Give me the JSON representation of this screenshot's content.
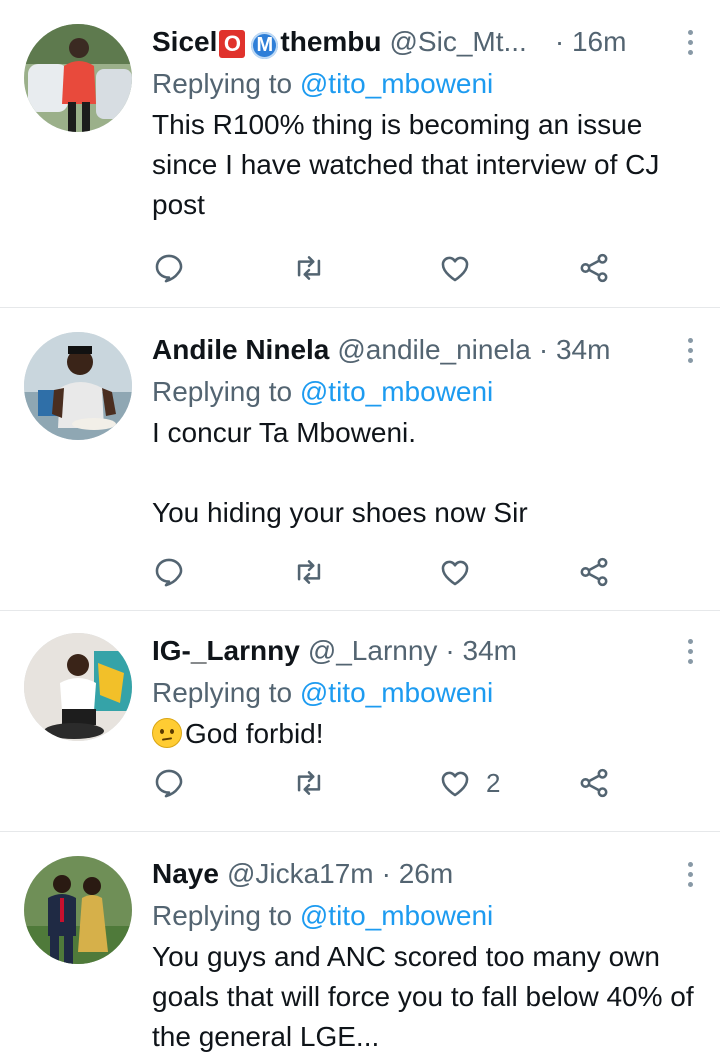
{
  "tweets": [
    {
      "name_part1": "Sicel",
      "name_badge": "O",
      "name_badge2": "M",
      "name_part2": "thembu",
      "handle": "@Sic_Mt...",
      "time": "· 16m",
      "replying_prefix": "Replying to",
      "replying_mention": "@tito_mboweni",
      "text": "This R100% thing is becoming an issue since I have watched that interview of CJ post",
      "likes": ""
    },
    {
      "name": "Andile Ninela",
      "handle": "@andile_ninela",
      "time": "· 34m",
      "replying_prefix": "Replying to",
      "replying_mention": "@tito_mboweni",
      "text": "I concur Ta Mboweni.\n\nYou hiding your shoes now Sir",
      "likes": ""
    },
    {
      "name": "IG-_Larnny",
      "handle": "@_Larnny",
      "time": "· 34m",
      "replying_prefix": "Replying to",
      "replying_mention": "@tito_mboweni",
      "emoji": "confused-face-emoji",
      "text": "God forbid!",
      "likes": "2"
    },
    {
      "name": "Naye",
      "handle": "@Jicka17m",
      "time": "· 26m",
      "replying_prefix": "Replying to",
      "replying_mention": "@tito_mboweni",
      "text": "You guys and ANC scored too many own goals that will force you to fall below 40% of the general LGE...",
      "likes": ""
    }
  ],
  "icons": {
    "reply": "reply-icon",
    "retweet": "retweet-icon",
    "like": "like-icon",
    "share": "share-icon",
    "more": "more-options-icon"
  },
  "colors": {
    "mention": "#1d9bf0",
    "muted": "#536471",
    "icon": "#536471",
    "divider": "#e6e8ea"
  }
}
